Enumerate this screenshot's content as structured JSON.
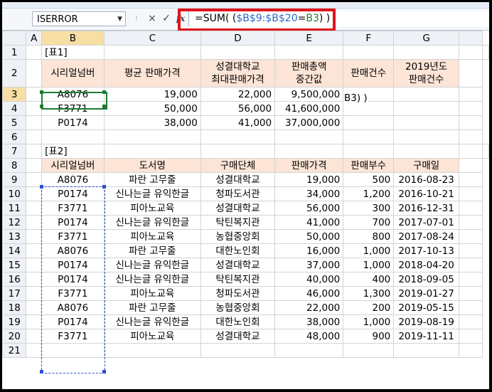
{
  "namebox": {
    "value": "ISERROR"
  },
  "formula_bar": {
    "cancel": "×",
    "enter": "✓",
    "fx": "fx",
    "formula_prefix": "=SUM( (",
    "formula_ref1": "$B$9:$B$20",
    "formula_eq": "=",
    "formula_ref2": "B3",
    "formula_suffix": ") )"
  },
  "columns": [
    "A",
    "B",
    "C",
    "D",
    "E",
    "F",
    "G"
  ],
  "rows": [
    "1",
    "2",
    "3",
    "4",
    "5",
    "6",
    "7",
    "8",
    "9",
    "10",
    "11",
    "12",
    "13",
    "14",
    "15",
    "16",
    "17",
    "18",
    "19",
    "20",
    "21"
  ],
  "table1": {
    "label": "[표1]",
    "headers": [
      [
        "시리얼넘버"
      ],
      [
        "평균 판매가격"
      ],
      [
        "성결대학교",
        "최대판매가격"
      ],
      [
        "판매총액",
        "중간값"
      ],
      [
        "판매건수"
      ],
      [
        "2019년도",
        "판매건수"
      ]
    ],
    "rows": [
      [
        "A8076",
        "19,000",
        "22,000",
        "9,500,000",
        "",
        ""
      ],
      [
        "F3771",
        "50,000",
        "56,000",
        "41,600,000",
        "",
        ""
      ],
      [
        "P0174",
        "38,000",
        "41,000",
        "37,000,000",
        "",
        ""
      ]
    ],
    "editing_text": "B3) )"
  },
  "table2": {
    "label": "[표2]",
    "headers": [
      "시리얼넘버",
      "도서명",
      "구매단체",
      "판매가격",
      "판매부수",
      "구매일"
    ],
    "rows": [
      [
        "A8076",
        "파란 고무줄",
        "성결대학교",
        "19,000",
        "500",
        "2016-08-23"
      ],
      [
        "P0174",
        "신나는글 유익한글",
        "청파도서관",
        "34,000",
        "1,200",
        "2016-10-21"
      ],
      [
        "F3771",
        "피아노교육",
        "성결대학교",
        "56,000",
        "300",
        "2016-12-31"
      ],
      [
        "P0174",
        "신나는글 유익한글",
        "탁틴복지관",
        "41,000",
        "700",
        "2017-07-01"
      ],
      [
        "F3771",
        "피아노교육",
        "농협중앙회",
        "50,000",
        "800",
        "2017-08-24"
      ],
      [
        "A8076",
        "파란 고무줄",
        "대한노인회",
        "16,000",
        "1,000",
        "2017-10-13"
      ],
      [
        "P0174",
        "신나는글 유익한글",
        "성결대학교",
        "37,000",
        "1,000",
        "2018-04-20"
      ],
      [
        "P0174",
        "신나는글 유익한글",
        "탁틴복지관",
        "40,000",
        "400",
        "2018-09-05"
      ],
      [
        "F3771",
        "피아노교육",
        "청파도서관",
        "46,000",
        "1,300",
        "2019-01-27"
      ],
      [
        "A8076",
        "파란 고무줄",
        "농협중앙회",
        "22,000",
        "200",
        "2019-05-15"
      ],
      [
        "P0174",
        "신나는글 유익한글",
        "대한노인회",
        "38,000",
        "1,000",
        "2019-08-19"
      ],
      [
        "F3771",
        "피아노교육",
        "성결대학교",
        "48,000",
        "900",
        "2019-11-11"
      ]
    ]
  },
  "colors": {
    "header_fill": "#fce4d6",
    "highlight_border": "#e0141c",
    "ref_blue": "#2d68c4",
    "ref_green": "#1e7b34"
  }
}
